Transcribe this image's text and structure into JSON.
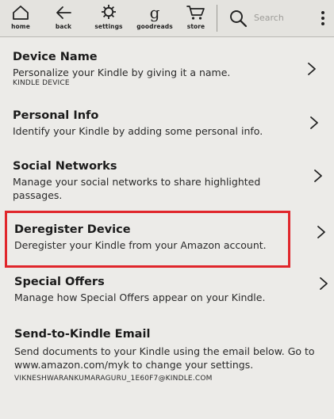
{
  "toolbar": {
    "home_label": "home",
    "back_label": "back",
    "settings_label": "settings",
    "goodreads_label": "goodreads",
    "store_label": "store",
    "goodreads_glyph": "g",
    "search_placeholder": "Search"
  },
  "rows": [
    {
      "title": "Device Name",
      "desc": "Personalize your Kindle by giving it a name.",
      "sub": "KINDLE DEVICE"
    },
    {
      "title": "Personal Info",
      "desc": "Identify your Kindle by adding some personal info."
    },
    {
      "title": "Social Networks",
      "desc": "Manage your social networks to share highlighted passages."
    },
    {
      "title": "Deregister Device",
      "desc": "Deregister your Kindle from your Amazon account."
    },
    {
      "title": "Special Offers",
      "desc": "Manage how Special Offers appear on your Kindle."
    },
    {
      "title": "Send-to-Kindle Email",
      "desc": "Send documents to your Kindle using the email below. Go to www.amazon.com/myk to change your settings.",
      "sub": "VIKNESHWARANKUMARAGURU_1E60F7@KINDLE.COM"
    }
  ],
  "icons": {
    "home": "home-icon",
    "back": "back-arrow-icon",
    "settings": "gear-icon",
    "goodreads": "goodreads-icon",
    "store": "cart-icon",
    "search": "search-icon",
    "menu": "more-vertical-icon",
    "chevron": "chevron-right-icon"
  },
  "colors": {
    "highlight_border": "#e0262b"
  }
}
